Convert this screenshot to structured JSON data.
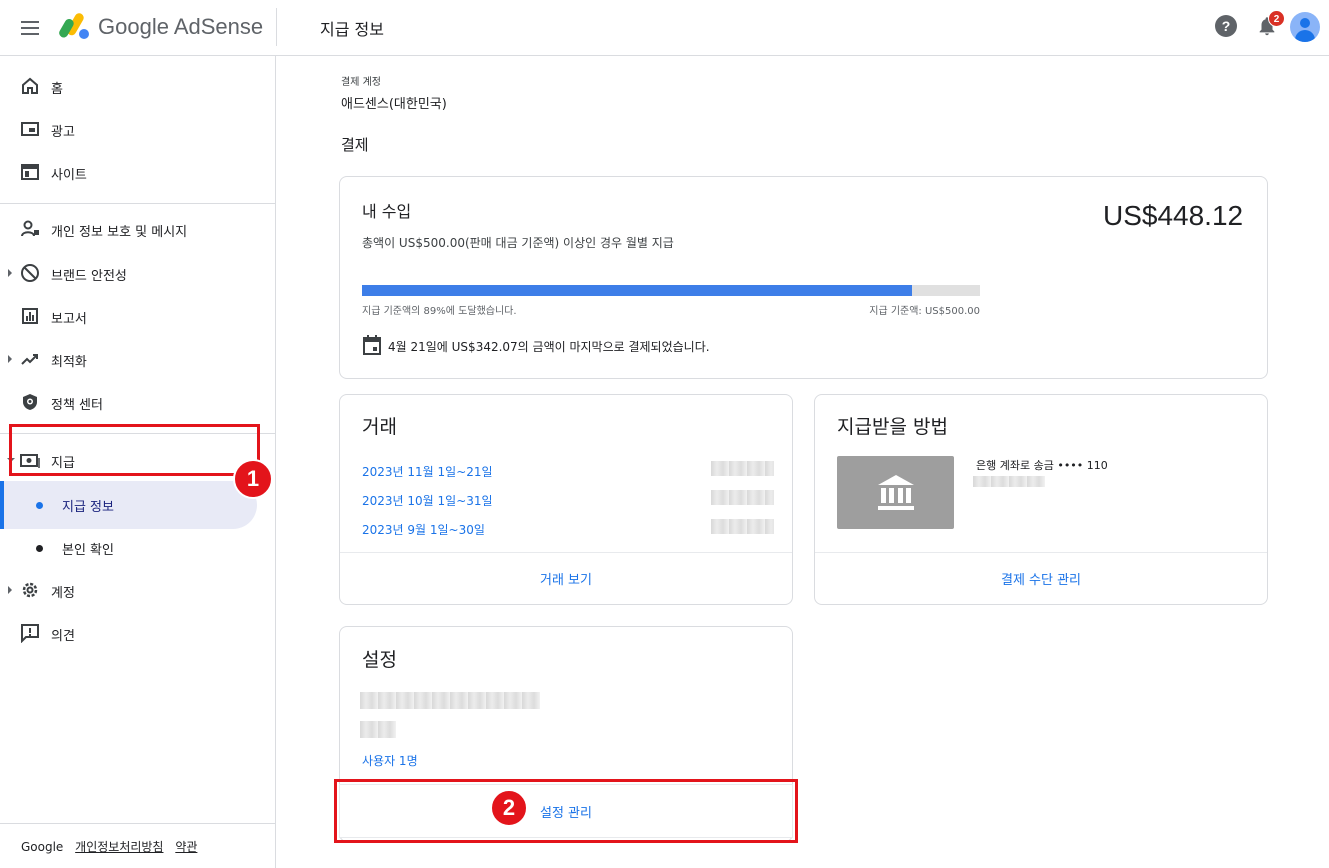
{
  "app": {
    "brand": "Google AdSense",
    "page_title": "지급 정보",
    "notification_count": "2"
  },
  "sidebar": {
    "items": [
      {
        "label": "홈",
        "icon": "home-icon"
      },
      {
        "label": "광고",
        "icon": "ads-icon"
      },
      {
        "label": "사이트",
        "icon": "sites-icon"
      },
      {
        "label": "개인 정보 보호 및 메시지",
        "icon": "privacy-icon"
      },
      {
        "label": "브랜드 안전성",
        "icon": "block-icon"
      },
      {
        "label": "보고서",
        "icon": "report-icon"
      },
      {
        "label": "최적화",
        "icon": "trending-icon"
      },
      {
        "label": "정책 센터",
        "icon": "policy-shield-icon"
      },
      {
        "label": "지급",
        "icon": "payments-icon"
      },
      {
        "label": "계정",
        "icon": "gear-icon"
      },
      {
        "label": "의견",
        "icon": "feedback-icon"
      }
    ],
    "subitems": [
      {
        "label": "지급 정보",
        "selected": true
      },
      {
        "label": "본인 확인",
        "selected": false
      }
    ],
    "footer": {
      "brand": "Google",
      "privacy": "개인정보처리방침",
      "terms": "약관"
    }
  },
  "annotations": {
    "step1": "1",
    "step2": "2"
  },
  "main": {
    "account_label": "결제 계정",
    "account_value": "애드센스(대한민국)",
    "section_title": "결제",
    "earnings": {
      "title": "내 수입",
      "amount": "US$448.12",
      "subtitle": "총액이 US$500.00(판매 대금 기준액) 이상인 경우 월별 지급",
      "progress_fraction": 0.89,
      "progress_left": "지급 기준액의 89%에 도달했습니다.",
      "progress_right": "지급 기준액: US$500.00",
      "last_payment": "4월 21일에 US$342.07의 금액이 마지막으로 결제되었습니다."
    },
    "transactions": {
      "title": "거래",
      "rows": [
        "2023년 11월 1일~21일",
        "2023년 10월 1일~31일",
        "2023년 9월 1일~30일"
      ],
      "action": "거래 보기"
    },
    "payment_method": {
      "title": "지급받을 방법",
      "bank_text": "은행 계좌로 송금 •••• 110",
      "action": "결제 수단 관리"
    },
    "settings": {
      "title": "설정",
      "users": "사용자 1명",
      "action": "설정 관리"
    }
  },
  "colors": {
    "accent": "#1a73e8",
    "progress": "#3d7ee8",
    "annotation": "#e3141b",
    "badge": "#d93025"
  }
}
